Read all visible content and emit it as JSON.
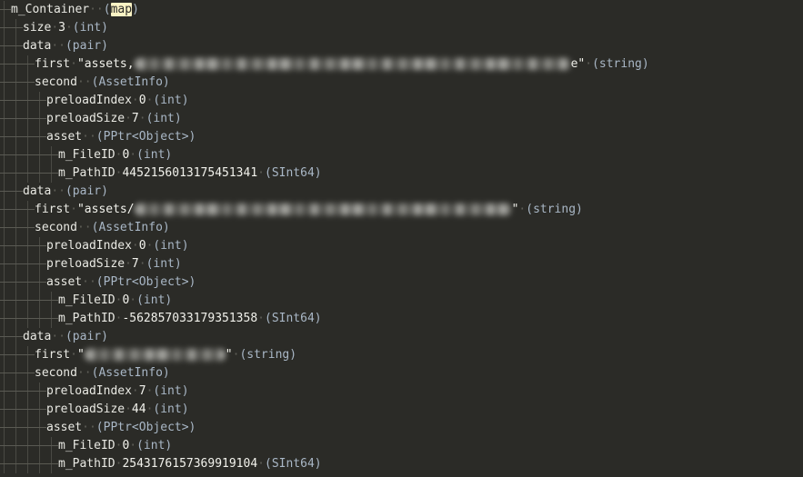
{
  "view": {
    "kind": "serialized-asset-tree",
    "background_color": "#2b2b27",
    "text_color": "#e8e8e2",
    "type_color": "#a9b7c6",
    "highlight_color": "#fbf3c4",
    "search_match": "map"
  },
  "separator": "·",
  "rows": [
    {
      "indent": 0,
      "name": "m_Container",
      "sep": "··",
      "type": "(map)",
      "type_highlight": "map",
      "highlighted": true
    },
    {
      "indent": 1,
      "name": "size",
      "value": "3",
      "type": "(int)"
    },
    {
      "indent": 1,
      "name": "data",
      "sep": "··",
      "type": "(pair)"
    },
    {
      "indent": 2,
      "name": "first",
      "string_prefix": "\"assets,",
      "redacted": "long",
      "string_suffix": "e\"",
      "type": "(string)"
    },
    {
      "indent": 2,
      "name": "second",
      "sep": "··",
      "type": "(AssetInfo)"
    },
    {
      "indent": 3,
      "name": "preloadIndex",
      "value": "0",
      "type": "(int)"
    },
    {
      "indent": 3,
      "name": "preloadSize",
      "value": "7",
      "type": "(int)"
    },
    {
      "indent": 3,
      "name": "asset",
      "sep": "··",
      "type": "(PPtr<Object>)"
    },
    {
      "indent": 4,
      "name": "m_FileID",
      "value": "0",
      "type": "(int)"
    },
    {
      "indent": 4,
      "name": "m_PathID",
      "value": "4452156013175451341",
      "type": "(SInt64)"
    },
    {
      "indent": 1,
      "name": "data",
      "sep": "··",
      "type": "(pair)"
    },
    {
      "indent": 2,
      "name": "first",
      "string_prefix": "\"assets/",
      "redacted": "long2",
      "string_suffix": "\"",
      "type": "(string)"
    },
    {
      "indent": 2,
      "name": "second",
      "sep": "··",
      "type": "(AssetInfo)"
    },
    {
      "indent": 3,
      "name": "preloadIndex",
      "value": "0",
      "type": "(int)"
    },
    {
      "indent": 3,
      "name": "preloadSize",
      "value": "7",
      "type": "(int)"
    },
    {
      "indent": 3,
      "name": "asset",
      "sep": "··",
      "type": "(PPtr<Object>)"
    },
    {
      "indent": 4,
      "name": "m_FileID",
      "value": "0",
      "type": "(int)"
    },
    {
      "indent": 4,
      "name": "m_PathID",
      "value": "-562857033179351358",
      "type": "(SInt64)"
    },
    {
      "indent": 1,
      "name": "data",
      "sep": "··",
      "type": "(pair)"
    },
    {
      "indent": 2,
      "name": "first",
      "string_prefix": "\"",
      "redacted": "short",
      "string_suffix": "\"",
      "type": "(string)"
    },
    {
      "indent": 2,
      "name": "second",
      "sep": "··",
      "type": "(AssetInfo)"
    },
    {
      "indent": 3,
      "name": "preloadIndex",
      "value": "7",
      "type": "(int)"
    },
    {
      "indent": 3,
      "name": "preloadSize",
      "value": "44",
      "type": "(int)"
    },
    {
      "indent": 3,
      "name": "asset",
      "sep": "··",
      "type": "(PPtr<Object>)"
    },
    {
      "indent": 4,
      "name": "m_FileID",
      "value": "0",
      "type": "(int)"
    },
    {
      "indent": 4,
      "name": "m_PathID",
      "value": "2543176157369919104",
      "type": "(SInt64)"
    }
  ]
}
